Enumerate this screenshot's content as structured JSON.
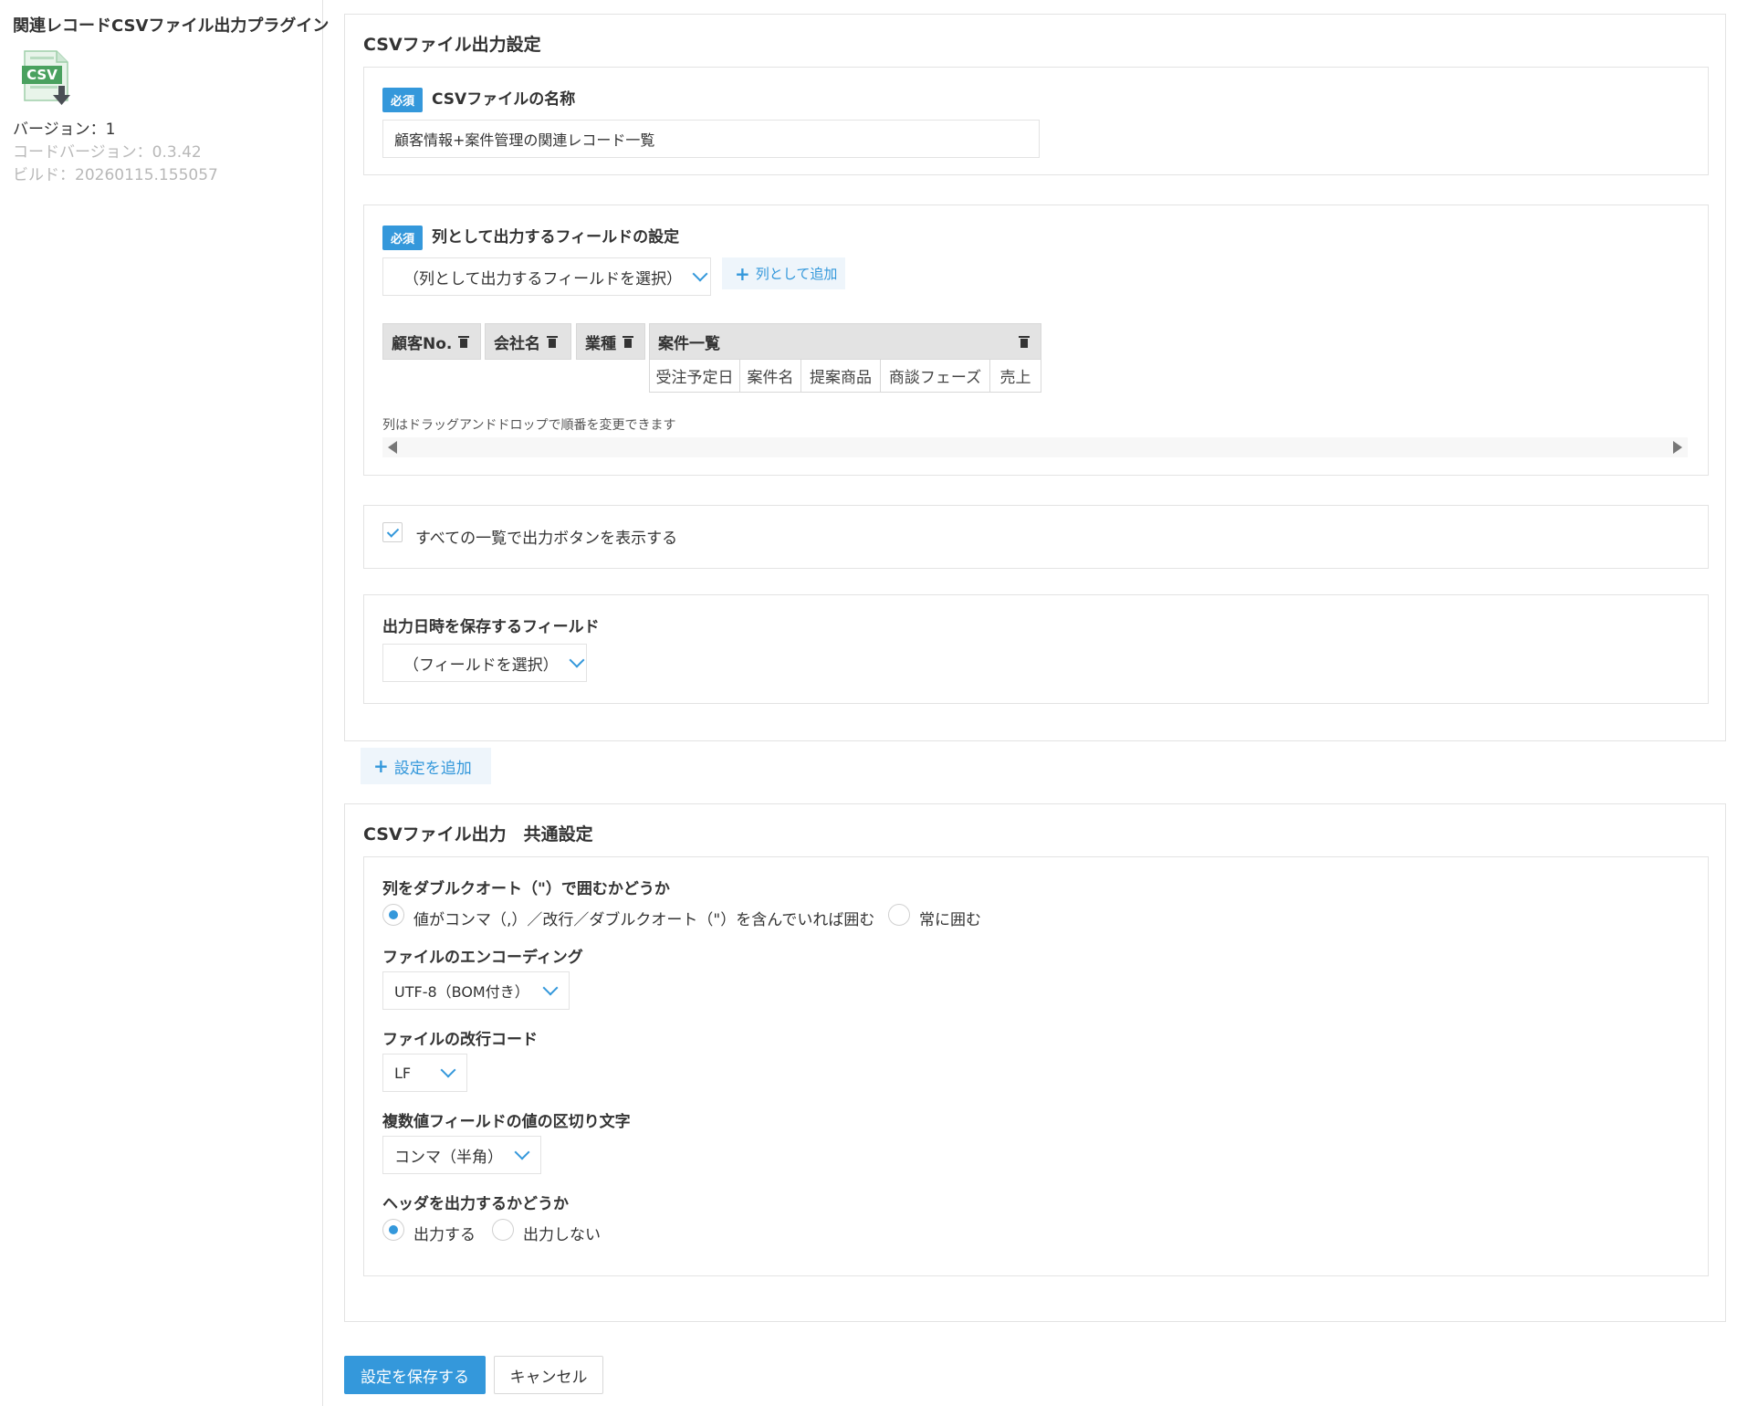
{
  "sidebar": {
    "title": "関連レコードCSVファイル出力プラグイン",
    "icon_label": "CSV",
    "version": "バージョン：1",
    "code_version": "コードバージョン：0.3.42",
    "build": "ビルド：20260115.155057"
  },
  "csv_settings": {
    "title": "CSVファイル出力設定",
    "required_badge": "必須",
    "file_name": {
      "label": "CSVファイルの名称",
      "value": "顧客情報+案件管理の関連レコード一覧"
    },
    "columns": {
      "label": "列として出力するフィールドの設定",
      "select_value": "（列として出力するフィールドを選択）",
      "add_button": "列として追加",
      "chips": [
        "顧客No.",
        "会社名",
        "業種"
      ],
      "group": {
        "label": "案件一覧",
        "subfields": [
          "受注予定日",
          "案件名",
          "提案商品",
          "商談フェーズ",
          "売上"
        ]
      },
      "hint": "列はドラッグアンドドロップで順番を変更できます"
    },
    "show_button": {
      "label": "すべての一覧で出力ボタンを表示する",
      "checked": true
    },
    "datetime_field": {
      "label": "出力日時を保存するフィールド",
      "select_value": "（フィールドを選択）"
    }
  },
  "add_setting_button": "設定を追加",
  "common": {
    "title": "CSVファイル出力　共通設定",
    "quote": {
      "label": "列をダブルクオート（\"）で囲むかどうか",
      "options": [
        "値がコンマ（,）／改行／ダブルクオート（\"）を含んでいれば囲む",
        "常に囲む"
      ],
      "selected": 0
    },
    "encoding": {
      "label": "ファイルのエンコーディング",
      "value": "UTF-8（BOM付き）"
    },
    "newline": {
      "label": "ファイルの改行コード",
      "value": "LF"
    },
    "separator": {
      "label": "複数値フィールドの値の区切り文字",
      "value": "コンマ（半角）"
    },
    "header": {
      "label": "ヘッダを出力するかどうか",
      "options": [
        "出力する",
        "出力しない"
      ],
      "selected": 0
    }
  },
  "footer": {
    "save": "設定を保存する",
    "cancel": "キャンセル"
  },
  "colors": {
    "accent": "#3498db",
    "border": "#e3e3e3",
    "muted": "#b8b8b8"
  }
}
